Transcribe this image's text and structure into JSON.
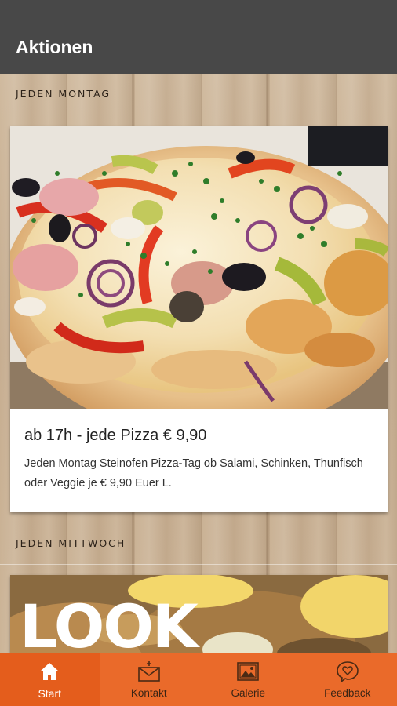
{
  "app_bar": {
    "title": "Aktionen"
  },
  "offers": [
    {
      "section_label": "JEDEN MONTAG",
      "title": "ab 17h - jede Pizza € 9,90",
      "description": "Jeden Montag Steinofen Pizza-Tag ob Salami, Schinken, Thunfisch oder Veggie je € 9,90 Euer L."
    },
    {
      "section_label": "JEDEN MITTWOCH",
      "logo_text": "LOOK"
    }
  ],
  "bottom_nav": [
    {
      "label": "Start",
      "icon": "home-icon",
      "active": true
    },
    {
      "label": "Kontakt",
      "icon": "mail-icon",
      "active": false
    },
    {
      "label": "Galerie",
      "icon": "image-icon",
      "active": false
    },
    {
      "label": "Feedback",
      "icon": "heart-chat-icon",
      "active": false
    }
  ],
  "colors": {
    "app_bar": "#484848",
    "nav_bar": "#ea6a2a",
    "wood": "#c9b297"
  }
}
